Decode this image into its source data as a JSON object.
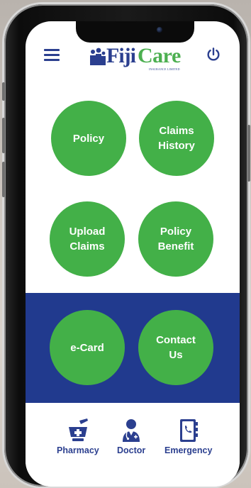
{
  "header": {
    "menu_icon": "hamburger-menu-icon",
    "power_icon": "power-icon",
    "logo": {
      "word1": "Fiji",
      "word2": "Care",
      "tagline": "INSURANCE LIMITED"
    }
  },
  "tiles": [
    {
      "label": "Policy"
    },
    {
      "label": "Claims\nHistory"
    },
    {
      "label": "Upload\nClaims"
    },
    {
      "label": "Policy\nBenefit"
    },
    {
      "label": "e-Card"
    },
    {
      "label": "Contact\nUs"
    }
  ],
  "bottom_nav": [
    {
      "label": "Pharmacy",
      "icon": "mortar-pestle-icon"
    },
    {
      "label": "Doctor",
      "icon": "doctor-icon"
    },
    {
      "label": "Emergency",
      "icon": "phone-book-icon"
    }
  ],
  "colors": {
    "brand_blue": "#2b3f8f",
    "band_blue": "#213a8e",
    "brand_green": "#43b048"
  }
}
